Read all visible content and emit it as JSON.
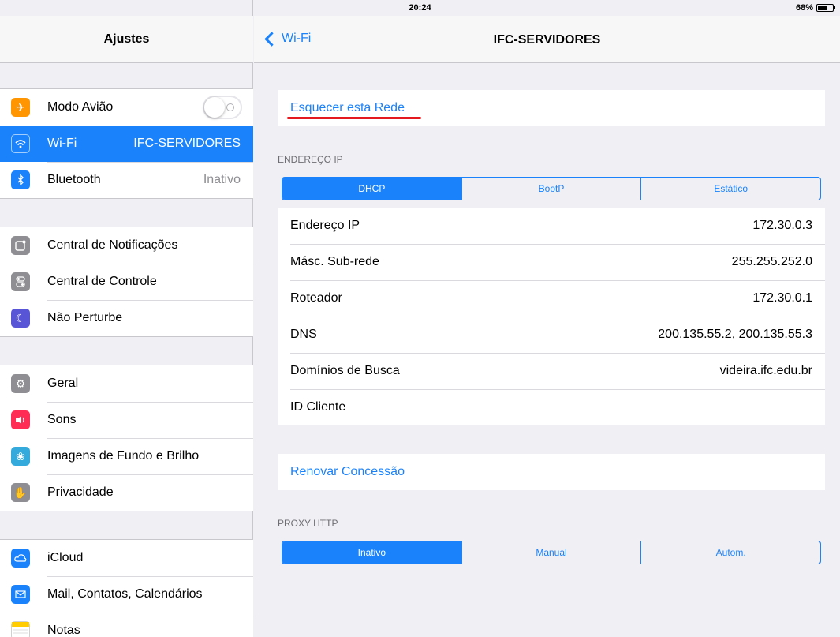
{
  "status": {
    "device": "iPad",
    "time": "20:24",
    "battery": "68%",
    "battery_level": 0.68
  },
  "sidebar": {
    "title": "Ajustes",
    "group1": [
      {
        "label": "Modo Avião",
        "icon": "airplane-icon",
        "color": "#ff9500"
      },
      {
        "label": "Wi-Fi",
        "value": "IFC-SERVIDORES",
        "icon": "wifi-icon",
        "color": "#1a82fb"
      },
      {
        "label": "Bluetooth",
        "value": "Inativo",
        "icon": "bluetooth-icon",
        "color": "#1a82fb"
      }
    ],
    "group2": [
      {
        "label": "Central de Notificações",
        "icon": "notifications-icon",
        "color": "#8e8e93"
      },
      {
        "label": "Central de Controle",
        "icon": "control-center-icon",
        "color": "#8e8e93"
      },
      {
        "label": "Não Perturbe",
        "icon": "moon-icon",
        "color": "#5856d6"
      }
    ],
    "group3": [
      {
        "label": "Geral",
        "icon": "gear-icon",
        "color": "#8e8e93"
      },
      {
        "label": "Sons",
        "icon": "speaker-icon",
        "color": "#ff2d55"
      },
      {
        "label": "Imagens de Fundo e Brilho",
        "icon": "flower-icon",
        "color": "#34aadc"
      },
      {
        "label": "Privacidade",
        "icon": "hand-icon",
        "color": "#8e8e93"
      }
    ],
    "group4": [
      {
        "label": "iCloud",
        "icon": "cloud-icon",
        "color": "#1a82fb"
      },
      {
        "label": "Mail, Contatos, Calendários",
        "icon": "mail-icon",
        "color": "#1a82fb"
      },
      {
        "label": "Notas",
        "icon": "notes-icon",
        "color": "#ffcc00"
      }
    ]
  },
  "detail": {
    "back_label": "Wi-Fi",
    "title": "IFC-SERVIDORES",
    "forget_label": "Esquecer esta Rede",
    "ip_section": "ENDEREÇO IP",
    "ip_modes": [
      "DHCP",
      "BootP",
      "Estático"
    ],
    "rows": [
      {
        "key": "Endereço IP",
        "value": "172.30.0.3"
      },
      {
        "key": "Másc. Sub-rede",
        "value": "255.255.252.0"
      },
      {
        "key": "Roteador",
        "value": "172.30.0.1"
      },
      {
        "key": "DNS",
        "value": "200.135.55.2, 200.135.55.3"
      },
      {
        "key": "Domínios de Busca",
        "value": "videira.ifc.edu.br"
      },
      {
        "key": "ID Cliente",
        "value": ""
      }
    ],
    "renew_label": "Renovar Concessão",
    "proxy_section": "PROXY HTTP",
    "proxy_modes": [
      "Inativo",
      "Manual",
      "Autom."
    ]
  }
}
